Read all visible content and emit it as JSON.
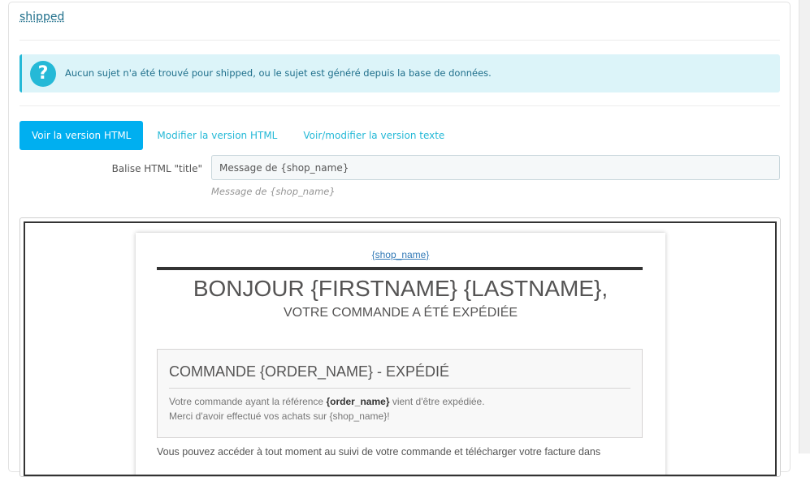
{
  "panel": {
    "heading": "shipped"
  },
  "alert": {
    "icon": "question-circle-icon",
    "icon_glyph": "?",
    "text": "Aucun sujet n'a été trouvé pour shipped, ou le sujet est généré depuis la base de données."
  },
  "tabs": [
    {
      "label": "Voir la version HTML",
      "active": true
    },
    {
      "label": "Modifier la version HTML",
      "active": false
    },
    {
      "label": "Voir/modifier la version texte",
      "active": false
    }
  ],
  "title_field": {
    "label": "Balise HTML \"title\"",
    "value": "Message de {shop_name}",
    "help": "Message de {shop_name}"
  },
  "email_preview": {
    "shop_link": "{shop_name}",
    "greeting": "BONJOUR {FIRSTNAME} {LASTNAME},",
    "subtitle": "VOTRE COMMANDE A ÉTÉ EXPÉDIÉE",
    "order_box": {
      "title": "COMMANDE {ORDER_NAME} - EXPÉDIÉ",
      "line1_before": "Votre commande ayant la référence ",
      "line1_bold": "{order_name}",
      "line1_after": " vient d'être expédiée.",
      "line2": "Merci d'avoir effectué vos achats sur {shop_name}!"
    },
    "footer_text": "Vous pouvez accéder à tout moment au suivi de votre commande et télécharger votre facture dans"
  },
  "colors": {
    "accent": "#25b9d7",
    "active_tab": "#00aff0",
    "alert_bg": "#dcf4f9"
  }
}
